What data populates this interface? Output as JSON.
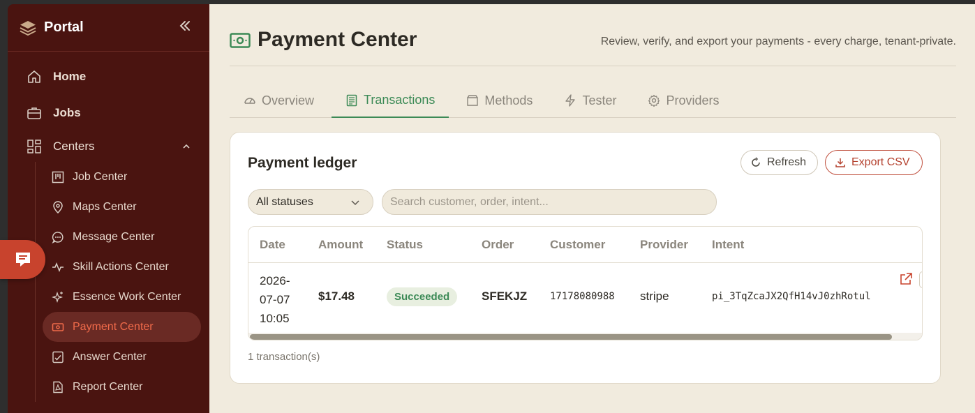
{
  "sidebar": {
    "brand": "Portal",
    "nav": [
      {
        "label": "Home"
      },
      {
        "label": "Jobs"
      }
    ],
    "centers_label": "Centers",
    "sub_items": [
      {
        "label": "Job Center"
      },
      {
        "label": "Maps Center"
      },
      {
        "label": "Message Center"
      },
      {
        "label": "Skill Actions Center"
      },
      {
        "label": "Essence Work Center"
      },
      {
        "label": "Payment Center"
      },
      {
        "label": "Answer Center"
      },
      {
        "label": "Report Center"
      }
    ],
    "active_item": "Payment Center"
  },
  "header": {
    "title": "Payment Center",
    "subtitle": "Review, verify, and export your payments - every charge, tenant-private."
  },
  "tabs": [
    {
      "label": "Overview",
      "icon": "gauge-icon"
    },
    {
      "label": "Transactions",
      "icon": "receipt-icon"
    },
    {
      "label": "Methods",
      "icon": "wallet-icon"
    },
    {
      "label": "Tester",
      "icon": "bolt-icon"
    },
    {
      "label": "Providers",
      "icon": "gear-icon"
    }
  ],
  "active_tab": "Transactions",
  "ledger": {
    "title": "Payment ledger",
    "refresh_label": "Refresh",
    "export_label": "Export CSV",
    "status_filter": "All statuses",
    "search_placeholder": "Search customer, order, intent...",
    "columns": [
      "Date",
      "Amount",
      "Status",
      "Order",
      "Customer",
      "Provider",
      "Intent"
    ],
    "rows": [
      {
        "date_line1": "2026-",
        "date_line2": "07-07",
        "date_line3": "10:05",
        "amount": "$17.48",
        "status": "Succeeded",
        "order": "SFEKJZ",
        "customer": "17178080988",
        "provider": "stripe",
        "intent": "pi_3TqZcaJX2QfH14vJ0zhRotul"
      }
    ],
    "count_text": "1 transaction(s)"
  },
  "colors": {
    "sidebar_bg": "#4a1410",
    "accent_red": "#c8432d",
    "accent_green": "#3c8a56",
    "main_bg": "#f1ebde"
  }
}
